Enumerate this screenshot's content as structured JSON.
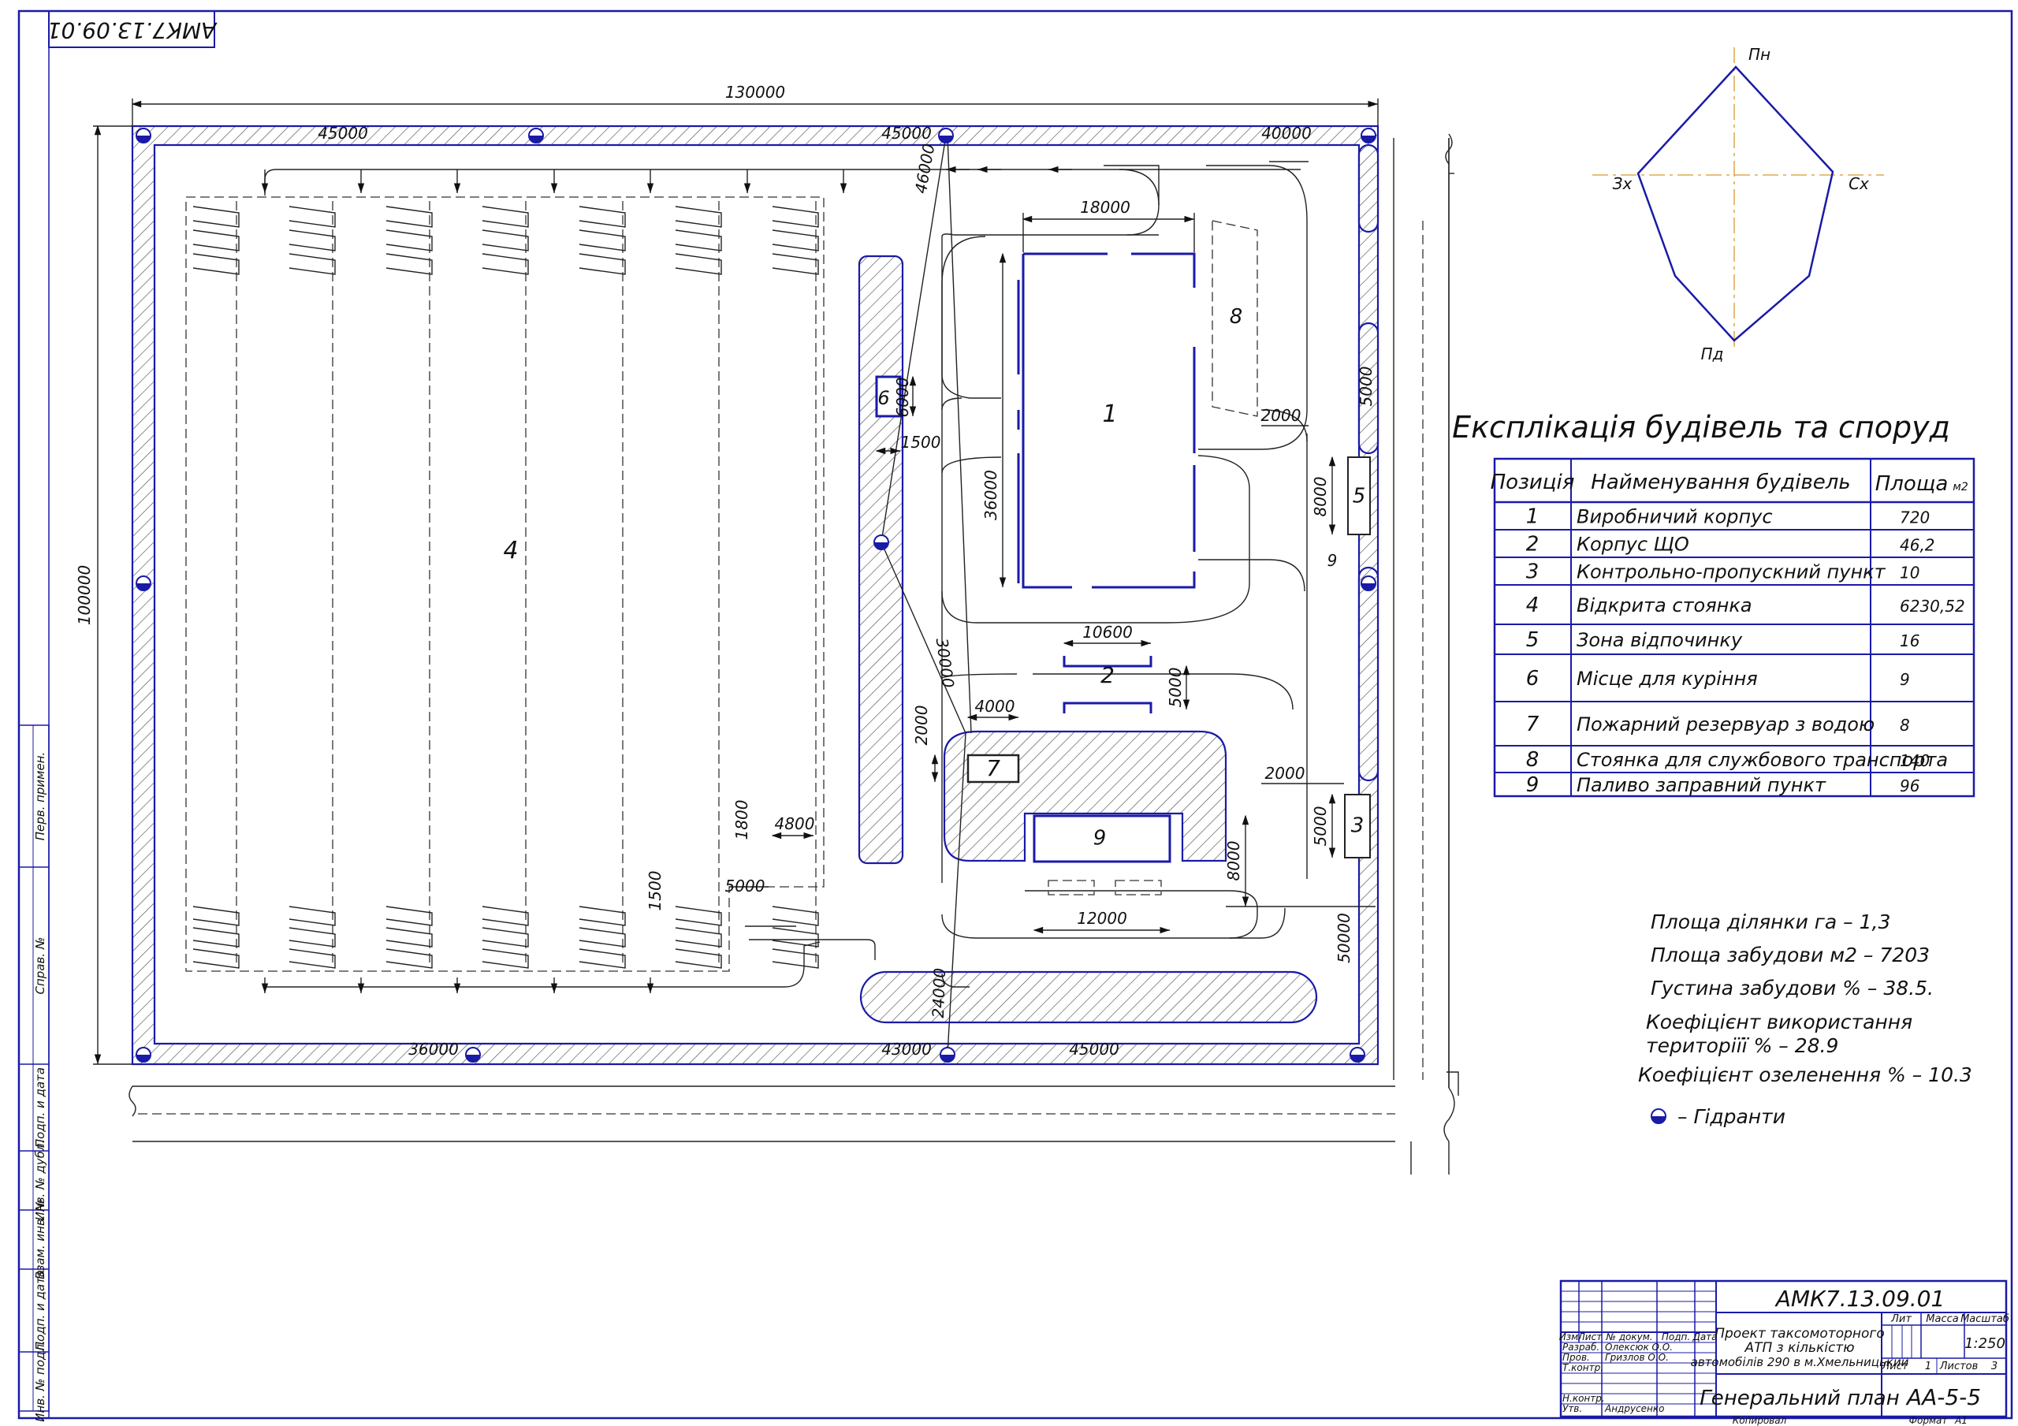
{
  "document_code_rotated": "АМК7.13.09.01",
  "compass": {
    "north": "Пн",
    "south": "Пд",
    "west": "Зх",
    "east": "Сх"
  },
  "dimensions": {
    "overall_width": "130000",
    "overall_height": "100000",
    "top_seg_1": "45000",
    "top_seg_2": "45000",
    "top_seg_3": "40000",
    "bottom_seg_1": "36000",
    "bottom_seg_2": "43000",
    "bottom_seg_3": "45000",
    "b1_width": "18000",
    "b1_height": "36000",
    "b2_width": "10600",
    "b2_offset": "5000",
    "b6_w": "6000",
    "b6_h": "1500",
    "b7_w": "4000",
    "b7_h": "2000",
    "b9_w": "12000",
    "b9_h": "8000",
    "b5_h": "8000",
    "b3_h": "5000",
    "right_gap_1": "5000",
    "right_gap_2": "50000",
    "gap_2000_a": "2000",
    "gap_2000_b": "2000",
    "num_9_side": "9",
    "diag_1": "46000",
    "diag_2": "24000",
    "diag_3": "30000",
    "p4_a": "4800",
    "p4_b": "1800",
    "p4_c": "5000",
    "p4_d": "1500"
  },
  "buildings": {
    "b1": "1",
    "b2": "2",
    "b3": "3",
    "b4": "4",
    "b5": "5",
    "b6": "6",
    "b7": "7",
    "b8": "8",
    "b9": "9"
  },
  "explication": {
    "title": "Експлікація будівель та споруд",
    "headers": {
      "pos": "Позиція",
      "name": "Найменування будівель",
      "area": "Площа",
      "area_unit": "м2"
    },
    "rows": [
      {
        "pos": "1",
        "name": "Виробничий корпус",
        "area": "720"
      },
      {
        "pos": "2",
        "name": "Корпус ЩО",
        "area": "46,2"
      },
      {
        "pos": "3",
        "name": "Контрольно-пропускний пункт",
        "area": "10"
      },
      {
        "pos": "4",
        "name": "Відкрита стоянка",
        "area": "6230,52"
      },
      {
        "pos": "5",
        "name": "Зона відпочинку",
        "area": "16"
      },
      {
        "pos": "6",
        "name": "Місце для куріння",
        "area": "9"
      },
      {
        "pos": "7",
        "name": "Пожарний резервуар з водою",
        "area": "8"
      },
      {
        "pos": "8",
        "name": "Стоянка для службового транспорта",
        "area": "140"
      },
      {
        "pos": "9",
        "name": "Паливо заправний пункт",
        "area": "96"
      }
    ]
  },
  "notes": {
    "n1": "Площа ділянки га – 1,3",
    "n2": "Площа забудови м2 – 7203",
    "n3": "Густина забудови % – 38.5.",
    "n4a": "Коефіцієнт використання",
    "n4b": "територіїї % – 28.9",
    "n5": "Коефіцієнт озеленення % – 10.3",
    "legend": "– Гідранти"
  },
  "side_stamp": {
    "s1": "Перв. примен.",
    "s2": "Справ. №",
    "s3": "Подп. и дата",
    "s4": "Инв. № дубл.",
    "s5": "Взам. инв. №",
    "s6": "Подп. и дата",
    "s7": "Инв. № подл."
  },
  "title_block": {
    "code": "АМК7.13.09.01",
    "project_l1": "Проект таксомоторного",
    "project_l2": "АТП з кількістю",
    "project_l3": "автомобілів 290 в м.Хмельницький",
    "sheet_title": "Генеральний план",
    "sheet_code": "АА-5-5",
    "lit": "Лит",
    "mass": "Масса",
    "scale_h": "Масштаб",
    "scale": "1:250",
    "sheet": "Лист",
    "sheet_no": "1",
    "sheets": "Листов",
    "sheets_no": "3",
    "izm": "Изм",
    "list": "Лист",
    "doc": "№ докум.",
    "podp": "Подп.",
    "data": "Дата",
    "razrab": "Разраб.",
    "razrab_name": "Олексюк О.О.",
    "prov": "Пров.",
    "prov_name": "Гризлов О.О.",
    "tkontr": "Т.контр.",
    "nkontr": "Н.контр.",
    "utv": "Утв.",
    "utv_name": "Андрусенко",
    "kopiroval": "Копировал",
    "format": "Формат",
    "format_val": "А1"
  }
}
